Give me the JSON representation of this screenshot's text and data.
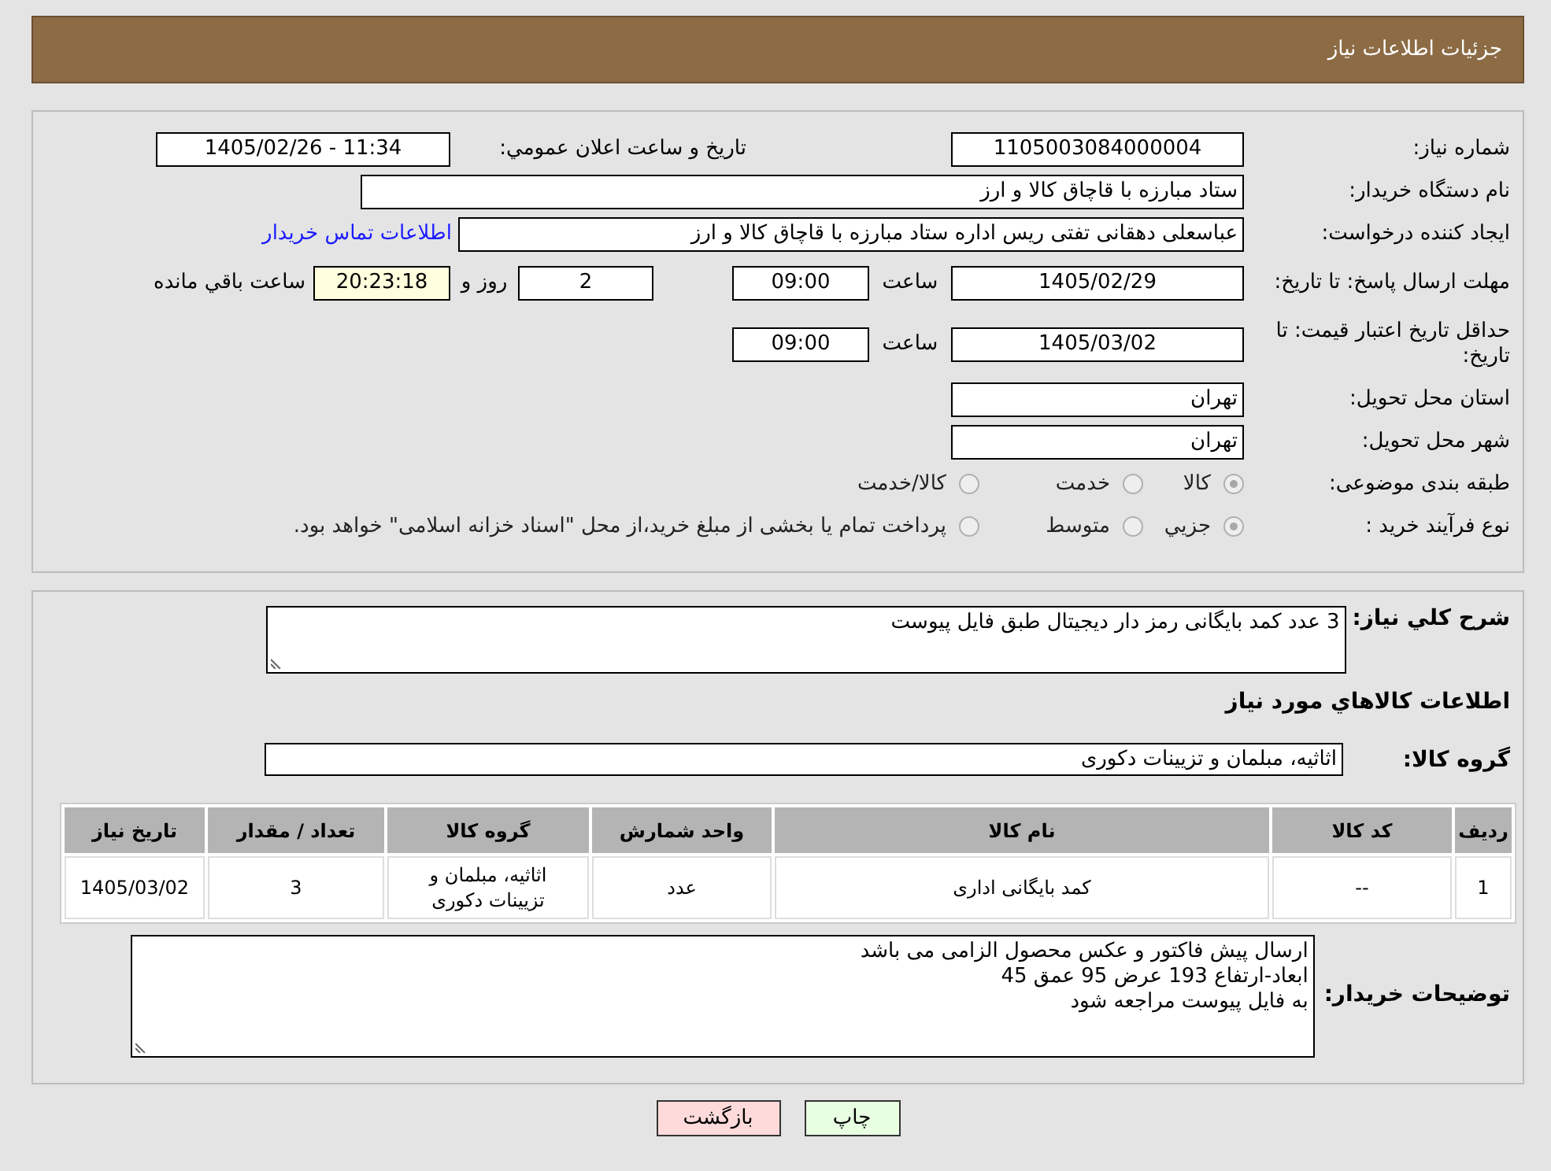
{
  "header": {
    "title": "جزئیات اطلاعات نیاز"
  },
  "need_number": {
    "label": "شماره نیاز:",
    "value": "1105003084000004"
  },
  "announce_date": {
    "label": "تاریخ و ساعت اعلان عمومي:",
    "value": "1405/02/26 - 11:34"
  },
  "buyer_org": {
    "label": "نام دستگاه خریدار:",
    "value": "ستاد مبارزه با قاچاق کالا و ارز"
  },
  "requester": {
    "label": "ایجاد کننده درخواست:",
    "value": "عباسعلی  دهقانی تفتی ریس اداره ستاد مبارزه با قاچاق کالا و ارز",
    "link": "اطلاعات تماس خریدار"
  },
  "response_deadline": {
    "label": "مهلت ارسال پاسخ: تا تاریخ:",
    "date": "1405/02/29",
    "time_label": "ساعت",
    "time": "09:00",
    "days": "2",
    "days_label": "روز و",
    "remaining": "20:23:18",
    "remaining_label": "ساعت باقي مانده"
  },
  "price_validity": {
    "label": "حداقل تاریخ اعتبار قیمت: تا تاریخ:",
    "date": "1405/03/02",
    "time_label": "ساعت",
    "time": "09:00"
  },
  "province": {
    "label": "استان محل تحویل:",
    "value": "تهران"
  },
  "city": {
    "label": "شهر محل تحویل:",
    "value": "تهران"
  },
  "category": {
    "label": "طبقه بندی موضوعی:",
    "options": [
      {
        "label": "کالا",
        "selected": true,
        "disabled": true
      },
      {
        "label": "خدمت",
        "selected": false,
        "disabled": true
      },
      {
        "label": "کالا/خدمت",
        "selected": false,
        "disabled": true
      }
    ]
  },
  "purchase_type": {
    "label": "نوع فرآیند خرید :",
    "options": [
      {
        "label": "جزيي",
        "selected": true,
        "disabled": true
      },
      {
        "label": "متوسط",
        "selected": false,
        "disabled": true
      },
      {
        "label": "پرداخت تمام یا بخشی از مبلغ خرید،از محل \"اسناد خزانه اسلامی\" خواهد بود.",
        "selected": false,
        "disabled": true
      }
    ]
  },
  "description": {
    "label": "شرح کلي نیاز:",
    "value": "3 عدد کمد بایگانی رمز دار دیجیتال طبق فایل پیوست"
  },
  "items_heading": "اطلاعات کالاهاي مورد نیاز",
  "goods_group": {
    "label": "گروه کالا:",
    "value": "اثاثیه، مبلمان و تزیینات دکوری"
  },
  "table": {
    "columns": [
      "ردیف",
      "کد کالا",
      "نام کالا",
      "واحد شمارش",
      "گروه کالا",
      "تعداد / مقدار",
      "تاریخ نیاز"
    ],
    "rows": [
      [
        "1",
        "--",
        "کمد بایگانی اداری",
        "عدد",
        "اثاثیه، مبلمان و تزیینات دکوری",
        "3",
        "1405/03/02"
      ]
    ]
  },
  "buyer_notes": {
    "label": "توضیحات خریدار:",
    "lines": [
      "ارسال پیش فاکتور و عکس محصول الزامی می باشد",
      "ابعاد-ارتفاع 193 عرض 95 عمق 45",
      "به فایل پیوست مراجعه شود"
    ]
  },
  "buttons": [
    {
      "label": "چاپ",
      "kind": "print"
    },
    {
      "label": "بازگشت",
      "kind": "back"
    }
  ]
}
